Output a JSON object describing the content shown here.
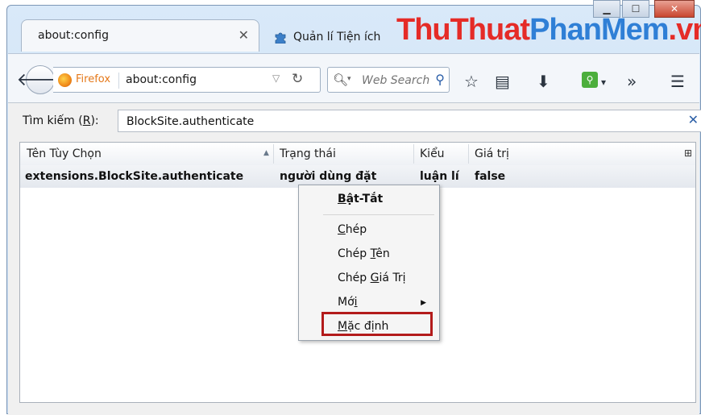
{
  "window": {
    "minimize_icon": "minimize-icon",
    "maximize_icon": "maximize-icon",
    "close_icon": "close-icon"
  },
  "tabs": [
    {
      "title": "about:config",
      "close": "✕"
    },
    {
      "title": "Quản lí Tiện ích"
    }
  ],
  "watermark": {
    "part1": "ThuThuat",
    "part2": "PhanMem",
    "part3": ".vn"
  },
  "navbar": {
    "identity": "Firefox",
    "url": "about:config",
    "search_placeholder": "Web Search"
  },
  "filter": {
    "label_prefix": "Tìm kiếm (",
    "label_key": "R",
    "label_suffix": "):",
    "value": "BlockSite.authenticate",
    "clear": "✕"
  },
  "table": {
    "columns": [
      "Tên Tùy Chọn",
      "Trạng thái",
      "Kiểu",
      "Giá trị"
    ],
    "rows": [
      {
        "name": "extensions.BlockSite.authenticate",
        "status": "người dùng đặt",
        "type": "luận lí",
        "value": "false"
      }
    ]
  },
  "context_menu": {
    "toggle": {
      "key": "B",
      "rest": "ật-Tắt"
    },
    "copy": {
      "key": "C",
      "rest": "hép"
    },
    "copy_name": {
      "pre": "Chép ",
      "key": "T",
      "rest": "ên"
    },
    "copy_value": {
      "pre": "Chép ",
      "key": "G",
      "rest": "iá Trị"
    },
    "new": {
      "pre": "Mớ",
      "key": "i",
      "rest": ""
    },
    "reset": {
      "key": "M",
      "rest": "ặc định"
    }
  },
  "colors": {
    "highlight_border": "#b31b1b",
    "firefox_orange": "#e57819"
  }
}
